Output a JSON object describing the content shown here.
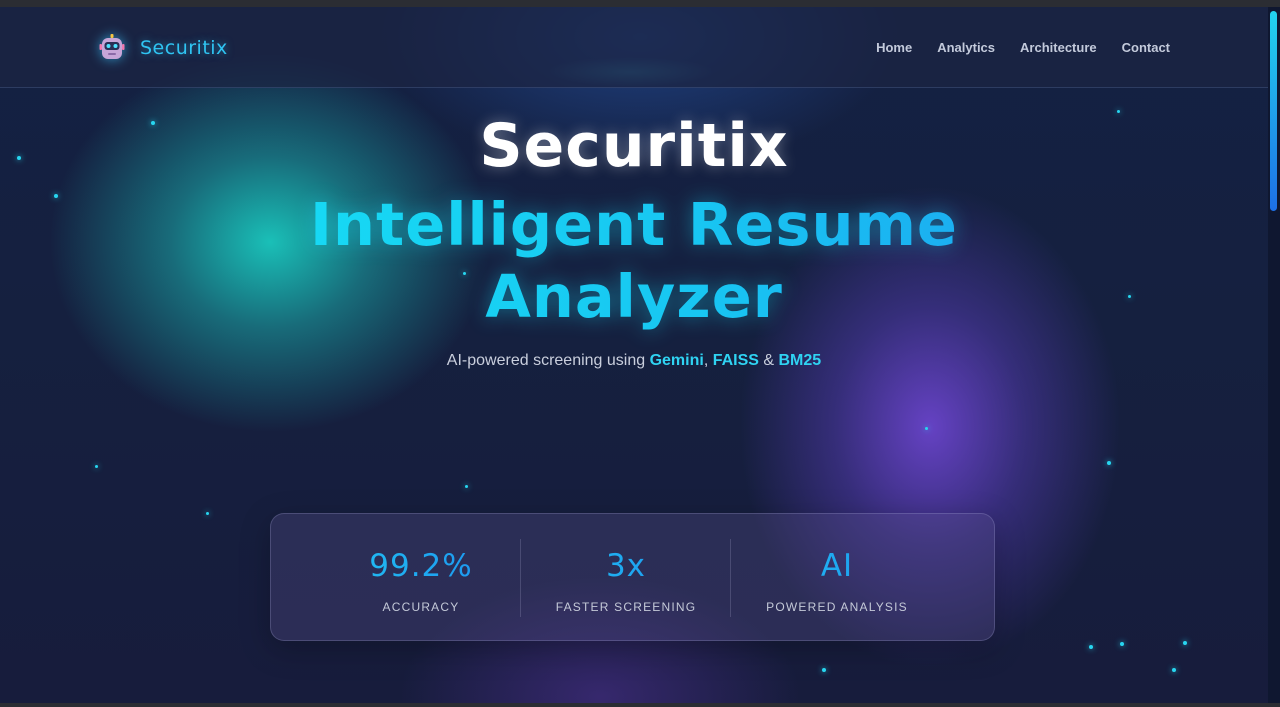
{
  "brand": {
    "name": "Securitix",
    "logo_icon": "robot-icon"
  },
  "nav": {
    "items": [
      {
        "label": "Home"
      },
      {
        "label": "Analytics"
      },
      {
        "label": "Architecture"
      },
      {
        "label": "Contact"
      }
    ]
  },
  "hero": {
    "title": "Securitix",
    "subtitle_line1": "Intelligent Resume",
    "subtitle_line2": "Analyzer",
    "tagline_prefix": "AI-powered screening using ",
    "tagline_tech1": "Gemini",
    "tagline_sep1": ", ",
    "tagline_tech2": "FAISS",
    "tagline_sep2": " & ",
    "tagline_tech3": "BM25"
  },
  "stats": [
    {
      "value": "99.2%",
      "label": "ACCURACY"
    },
    {
      "value": "3x",
      "label": "FASTER SCREENING"
    },
    {
      "value": "AI",
      "label": "POWERED ANALYSIS"
    }
  ],
  "colors": {
    "accent_cyan": "#22d3ee",
    "accent_blue": "#1d8cf0",
    "background": "#15203f",
    "glow_teal": "#1ac8be",
    "glow_purple": "#6e46d2"
  }
}
